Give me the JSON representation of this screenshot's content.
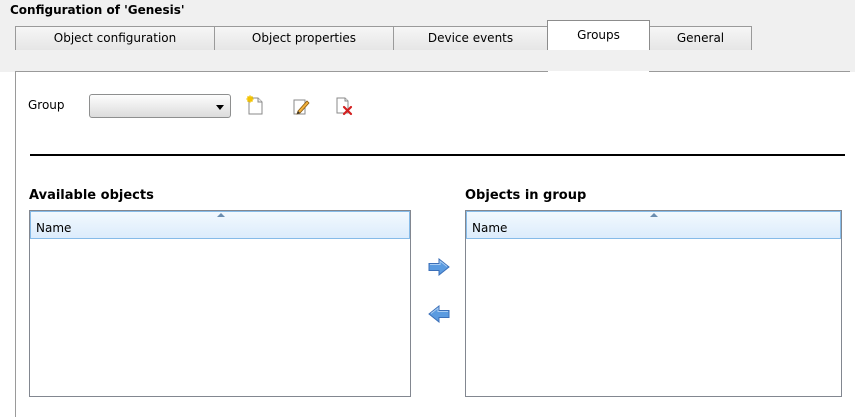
{
  "window": {
    "title": "Configuration of 'Genesis'"
  },
  "tabs": [
    {
      "label": "Object configuration",
      "active": false
    },
    {
      "label": "Object properties",
      "active": false
    },
    {
      "label": "Device events",
      "active": false
    },
    {
      "label": "Groups",
      "active": true
    },
    {
      "label": "General",
      "active": false
    }
  ],
  "toolbar": {
    "group_label": "Group",
    "group_value": "",
    "icons": [
      "new-group-icon",
      "edit-group-icon",
      "delete-group-icon"
    ]
  },
  "available": {
    "label": "Available objects",
    "column": "Name"
  },
  "in_group": {
    "label": "Objects in group",
    "column": "Name"
  },
  "transfer": {
    "icons": [
      "move-right-arrow-icon",
      "move-left-arrow-icon"
    ]
  },
  "colors": {
    "arrow_blue": "#5b9be0",
    "header_blue": "#dcecfc",
    "header_border": "#86bbe8"
  }
}
